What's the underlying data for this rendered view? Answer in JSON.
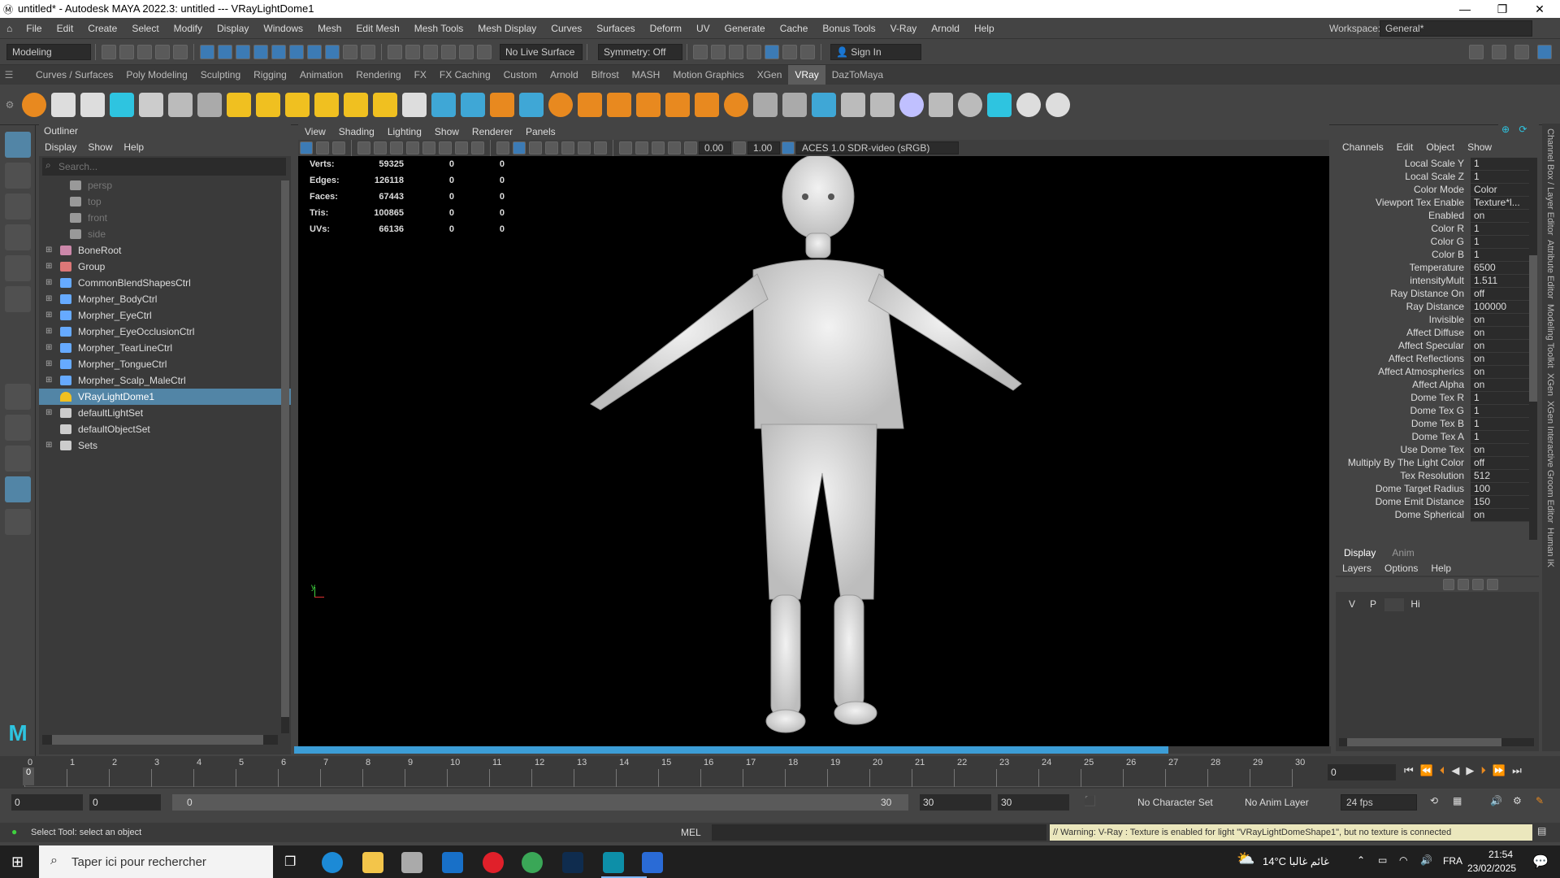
{
  "window": {
    "title": "untitled* - Autodesk MAYA 2022.3: untitled   ---   VRayLightDome1"
  },
  "menubar": {
    "items": [
      "File",
      "Edit",
      "Create",
      "Select",
      "Modify",
      "Display",
      "Windows",
      "Mesh",
      "Edit Mesh",
      "Mesh Tools",
      "Mesh Display",
      "Curves",
      "Surfaces",
      "Deform",
      "UV",
      "Generate",
      "Cache",
      "Bonus Tools",
      "V-Ray",
      "Arnold",
      "Help"
    ],
    "workspace_label": "Workspace:",
    "workspace_value": "General*"
  },
  "statusline": {
    "mode": "Modeling",
    "live_surface": "No Live Surface",
    "symmetry": "Symmetry: Off",
    "sign_in": "Sign In"
  },
  "shelf_tabs": [
    "Curves / Surfaces",
    "Poly Modeling",
    "Sculpting",
    "Rigging",
    "Animation",
    "Rendering",
    "FX",
    "FX Caching",
    "Custom",
    "Arnold",
    "Bifrost",
    "MASH",
    "Motion Graphics",
    "XGen",
    "VRay",
    "DazToMaya"
  ],
  "shelf_active": "VRay",
  "outliner": {
    "title": "Outliner",
    "menu": [
      "Display",
      "Show",
      "Help"
    ],
    "search_placeholder": "Search...",
    "items": [
      {
        "label": "persp",
        "icon": "camera-icon",
        "expand": "",
        "dim": true
      },
      {
        "label": "top",
        "icon": "camera-icon",
        "expand": "",
        "dim": true
      },
      {
        "label": "front",
        "icon": "camera-icon",
        "expand": "",
        "dim": true
      },
      {
        "label": "side",
        "icon": "camera-icon",
        "expand": "",
        "dim": true
      },
      {
        "label": "BoneRoot",
        "icon": "joint-icon",
        "expand": "⊞",
        "dim": false
      },
      {
        "label": "Group",
        "icon": "group-icon",
        "expand": "⊞",
        "dim": false
      },
      {
        "label": "CommonBlendShapesCtrl",
        "icon": "curve-icon",
        "expand": "⊞",
        "dim": false
      },
      {
        "label": "Morpher_BodyCtrl",
        "icon": "curve-icon",
        "expand": "⊞",
        "dim": false
      },
      {
        "label": "Morpher_EyeCtrl",
        "icon": "curve-icon",
        "expand": "⊞",
        "dim": false
      },
      {
        "label": "Morpher_EyeOcclusionCtrl",
        "icon": "curve-icon",
        "expand": "⊞",
        "dim": false
      },
      {
        "label": "Morpher_TearLineCtrl",
        "icon": "curve-icon",
        "expand": "⊞",
        "dim": false
      },
      {
        "label": "Morpher_TongueCtrl",
        "icon": "curve-icon",
        "expand": "⊞",
        "dim": false
      },
      {
        "label": "Morpher_Scalp_MaleCtrl",
        "icon": "curve-icon",
        "expand": "⊞",
        "dim": false
      },
      {
        "label": "VRayLightDome1",
        "icon": "dome-light-icon",
        "expand": "",
        "dim": false,
        "selected": true
      },
      {
        "label": "defaultLightSet",
        "icon": "set-icon",
        "expand": "⊞",
        "dim": false
      },
      {
        "label": "defaultObjectSet",
        "icon": "set-icon",
        "expand": "",
        "dim": false
      },
      {
        "label": "Sets",
        "icon": "set-icon",
        "expand": "⊞",
        "dim": false
      }
    ]
  },
  "viewport": {
    "menu": [
      "View",
      "Shading",
      "Lighting",
      "Show",
      "Renderer",
      "Panels"
    ],
    "exposure": "0.00",
    "gamma": "1.00",
    "color_space": "ACES 1.0 SDR-video (sRGB)",
    "hud": [
      {
        "label": "Verts:",
        "v": "59325",
        "a": "0",
        "b": "0"
      },
      {
        "label": "Edges:",
        "v": "126118",
        "a": "0",
        "b": "0"
      },
      {
        "label": "Faces:",
        "v": "67443",
        "a": "0",
        "b": "0"
      },
      {
        "label": "Tris:",
        "v": "100865",
        "a": "0",
        "b": "0"
      },
      {
        "label": "UVs:",
        "v": "66136",
        "a": "0",
        "b": "0"
      }
    ],
    "progress": 0.843
  },
  "channels": {
    "menu": [
      "Channels",
      "Edit",
      "Object",
      "Show"
    ],
    "attrs": [
      {
        "n": "Local Scale Y",
        "v": "1"
      },
      {
        "n": "Local Scale Z",
        "v": "1"
      },
      {
        "n": "Color Mode",
        "v": "Color"
      },
      {
        "n": "Viewport Tex Enable",
        "v": "Texture*l..."
      },
      {
        "n": "Enabled",
        "v": "on"
      },
      {
        "n": "Color R",
        "v": "1"
      },
      {
        "n": "Color G",
        "v": "1"
      },
      {
        "n": "Color B",
        "v": "1"
      },
      {
        "n": "Temperature",
        "v": "6500"
      },
      {
        "n": "intensityMult",
        "v": "1.511"
      },
      {
        "n": "Ray Distance On",
        "v": "off"
      },
      {
        "n": "Ray Distance",
        "v": "100000"
      },
      {
        "n": "Invisible",
        "v": "on"
      },
      {
        "n": "Affect Diffuse",
        "v": "on"
      },
      {
        "n": "Affect Specular",
        "v": "on"
      },
      {
        "n": "Affect Reflections",
        "v": "on"
      },
      {
        "n": "Affect Atmospherics",
        "v": "on"
      },
      {
        "n": "Affect Alpha",
        "v": "on"
      },
      {
        "n": "Dome Tex R",
        "v": "1"
      },
      {
        "n": "Dome Tex G",
        "v": "1"
      },
      {
        "n": "Dome Tex B",
        "v": "1"
      },
      {
        "n": "Dome Tex A",
        "v": "1"
      },
      {
        "n": "Use Dome Tex",
        "v": "on"
      },
      {
        "n": "Multiply By The Light Color",
        "v": "off"
      },
      {
        "n": "Tex Resolution",
        "v": "512"
      },
      {
        "n": "Dome Target Radius",
        "v": "100"
      },
      {
        "n": "Dome Emit Distance",
        "v": "150"
      },
      {
        "n": "Dome Spherical",
        "v": "on"
      }
    ]
  },
  "layers": {
    "tabs": [
      "Display",
      "Anim"
    ],
    "menu": [
      "Layers",
      "Options",
      "Help"
    ],
    "cols": [
      "V",
      "P",
      "",
      "Hi"
    ]
  },
  "right_strip": [
    "Channel Box / Layer Editor",
    "Attribute Editor",
    "Modeling Toolkit",
    "XGen",
    "XGen Interactive Groom Editor",
    "Human IK"
  ],
  "timeline": {
    "ticks": [
      "0",
      "1",
      "2",
      "3",
      "4",
      "5",
      "6",
      "7",
      "8",
      "9",
      "10",
      "11",
      "12",
      "13",
      "14",
      "15",
      "16",
      "17",
      "18",
      "19",
      "20",
      "21",
      "22",
      "23",
      "24",
      "25",
      "26",
      "27",
      "28",
      "29",
      "30"
    ],
    "current": "0"
  },
  "range": {
    "start": "0",
    "inner_start": "0",
    "slider_start": "0",
    "slider_end": "30",
    "end": "30",
    "outer_end": "30",
    "character_set": "No Character Set",
    "anim_layer": "No Anim Layer",
    "fps": "24 fps"
  },
  "cmd": {
    "help": "Select Tool: select an object",
    "lang": "MEL",
    "warning": "// Warning: V-Ray : Texture is enabled for light \"VRayLightDomeShape1\", but no texture is connected"
  },
  "taskbar": {
    "search": "Taper ici pour rechercher",
    "weather": "14°C  غائم غالبا",
    "lang": "FRA",
    "time": "21:54",
    "date": "23/02/2025"
  }
}
